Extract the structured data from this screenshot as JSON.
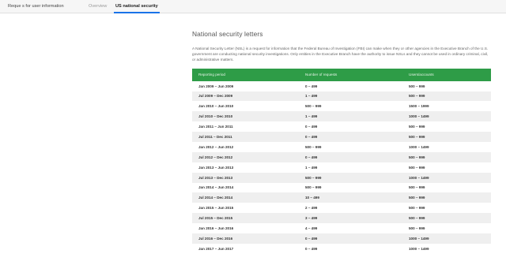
{
  "tabs": [
    {
      "label": "Reque s for user information"
    },
    {
      "label": "Overview"
    },
    {
      "label": "US national security"
    }
  ],
  "main": {
    "title": "National security letters",
    "description": "A National Security Letter (NSL) is a request for information that the Federal Bureau of Investigation (FBI) can make when they or other agencies in the Executive Branch of the U.S. government are conducting national security investigations. Only entities in the Executive Branch have the authority to issue NSLs and they cannot be used in ordinary criminal, civil, or administrative matters."
  },
  "table": {
    "headers": [
      "Reporting period",
      "Number of requests",
      "Users/accounts"
    ],
    "rows": [
      [
        "Jan 2009 – Jun 2009",
        "0 – 499",
        "500 – 999"
      ],
      [
        "Jul 2009 – Dec 2009",
        "1 – 499",
        "500 – 999"
      ],
      [
        "Jan 2010 – Jun 2010",
        "500 – 999",
        "1500 – 1999"
      ],
      [
        "Jul 2010 – Dec 2010",
        "1 – 499",
        "1000 – 1499"
      ],
      [
        "Jan 2011 – Jun 2011",
        "0 – 499",
        "500 – 999"
      ],
      [
        "Jul 2011 – Dec 2011",
        "0 – 499",
        "500 – 999"
      ],
      [
        "Jan 2012 – Jun 2012",
        "500 – 999",
        "1000 – 1499"
      ],
      [
        "Jul 2012 – Dec 2012",
        "0 – 499",
        "500 – 999"
      ],
      [
        "Jan 2013 – Jun 2013",
        "1 – 499",
        "500 – 999"
      ],
      [
        "Jul 2013 – Dec 2013",
        "500 – 999",
        "1000 – 1499"
      ],
      [
        "Jan 2014 – Jun 2014",
        "500 – 999",
        "500 – 999"
      ],
      [
        "Jul 2014 – Dec 2014",
        "10 – 499",
        "500 – 999"
      ],
      [
        "Jan 2015 – Jun 2015",
        "2 – 499",
        "500 – 999"
      ],
      [
        "Jul 2015 – Dec 2015",
        "3 – 499",
        "500 – 999"
      ],
      [
        "Jan 2016 – Jun 2016",
        "4 – 499",
        "500 – 999"
      ],
      [
        "Jul 2016 – Dec 2016",
        "0 – 499",
        "1000 – 1499"
      ],
      [
        "Jan 2017 – Jun 2017",
        "0 – 499",
        "1000 – 1499"
      ]
    ]
  },
  "colors": {
    "header_bg": "#2e9c47",
    "tab_indicator": "#1a73e8"
  }
}
